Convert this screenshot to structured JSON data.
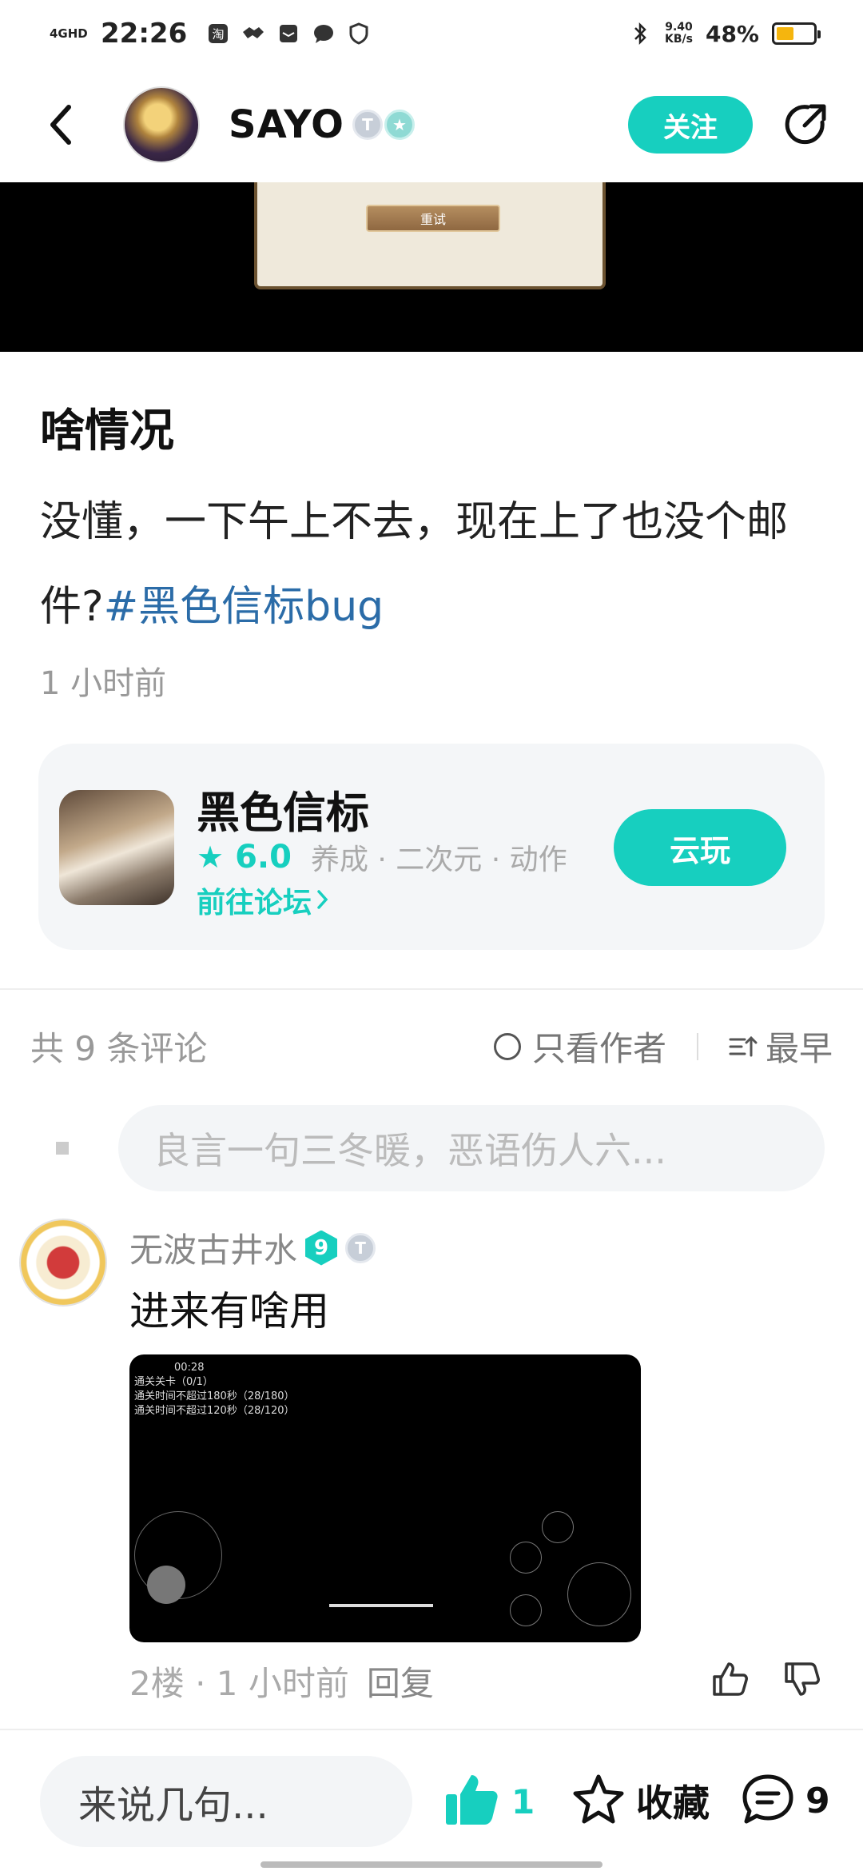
{
  "status_bar": {
    "network": "4GHD",
    "time": "22:26",
    "speed_value": "9.40",
    "speed_unit": "KB/s",
    "battery_percent": "48%",
    "battery_level": 0.48
  },
  "header": {
    "user_name": "SAYO",
    "follow_label": "关注"
  },
  "media": {
    "retry_label": "重试"
  },
  "post": {
    "title": "啥情况",
    "body_text": "没懂，一下午上不去，现在上了也没个邮件?",
    "hashtag": "#黑色信标bug",
    "time": "1 小时前"
  },
  "game_card": {
    "name": "黑色信标",
    "rating": "6.0",
    "tags": "养成 · 二次元 · 动作",
    "forum_link": "前往论坛",
    "cloud_play_label": "云玩"
  },
  "comments_header": {
    "count_text": "共 9 条评论",
    "author_only_label": "只看作者",
    "sort_label": "最早"
  },
  "comment_input": {
    "placeholder": "良言一句三冬暖，恶语伤人六..."
  },
  "comments": [
    {
      "user_name": "无波古井水",
      "level_badge": "9",
      "text": "进来有啥用",
      "hud_time": "00:28",
      "hud_lines": [
        "通关关卡（0/1）",
        "通关时间不超过180秒（28/180）",
        "通关时间不超过120秒（28/120）"
      ],
      "floor_time": "2楼 · 1 小时前",
      "reply_label": "回复"
    }
  ],
  "bottom_bar": {
    "input_placeholder": "来说几句...",
    "like_count": "1",
    "favorite_label": "收藏",
    "comment_count": "9"
  },
  "colors": {
    "accent": "#17cfbf",
    "hashtag": "#2b6ca8",
    "battery": "#f5b50e"
  }
}
